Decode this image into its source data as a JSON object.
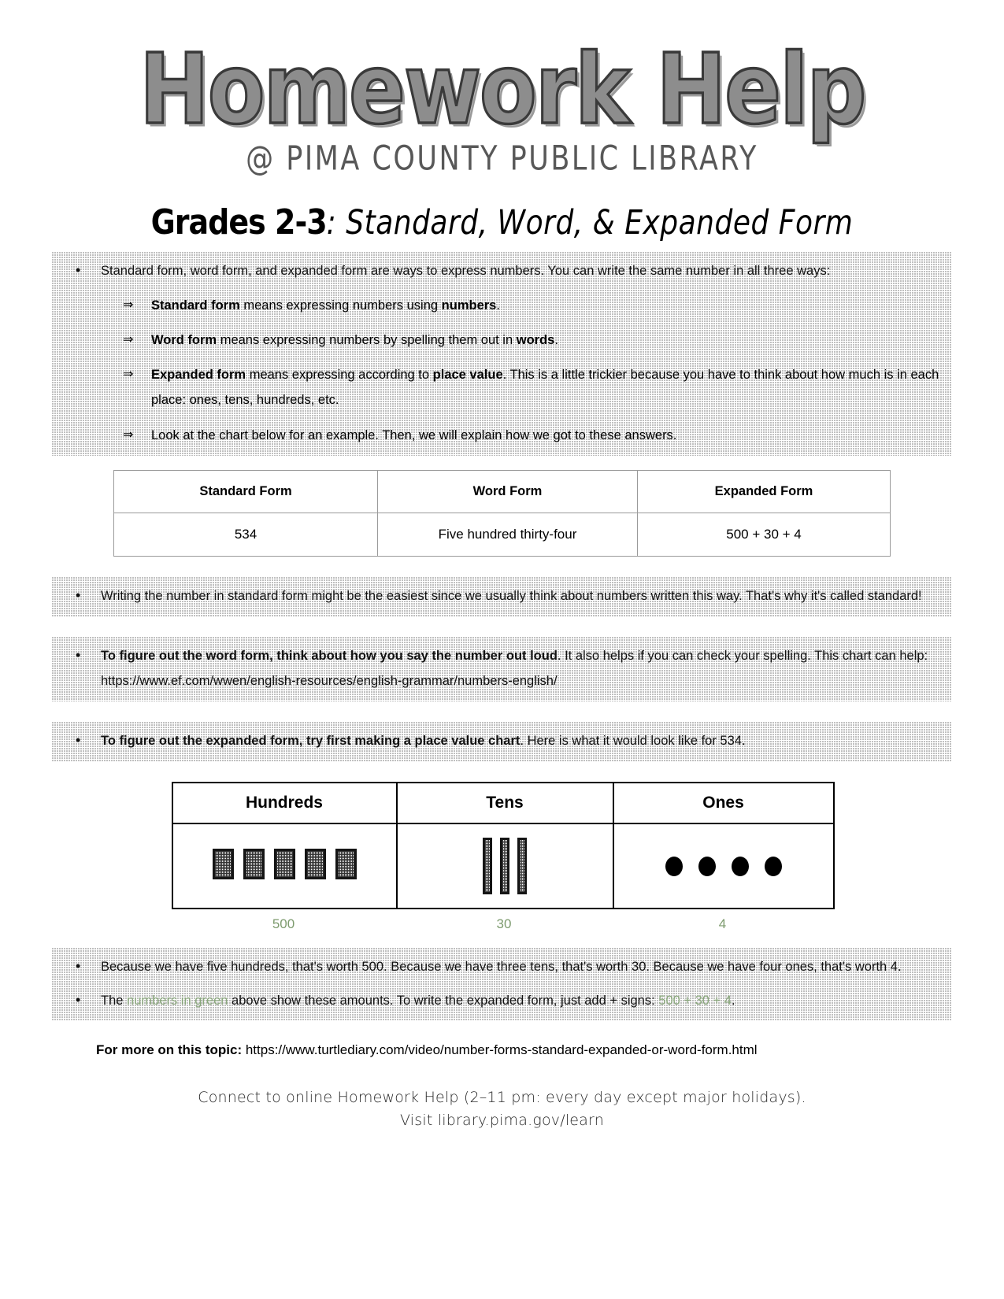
{
  "header": {
    "logo_main": "Homework Help",
    "logo_sub": "@ PIMA COUNTY PUBLIC LIBRARY"
  },
  "title": {
    "grade": "Grades 2-3",
    "rest": ": Standard, Word, & Expanded Form"
  },
  "intro": {
    "bullet": "Standard form, word form, and expanded form are ways to express numbers. You can write the same number in all three ways:",
    "sub_items": [
      {
        "bold": "Standard form",
        "text": " means expressing numbers using ",
        "bold2": "numbers",
        "tail": "."
      },
      {
        "bold": "Word form",
        "text": " means expressing numbers by spelling them out in ",
        "bold2": "words",
        "tail": "."
      },
      {
        "bold": "Expanded form",
        "text": " means expressing according to ",
        "bold2": "place value",
        "tail": ". This is a little trickier because you have to think about how much is in each place: ones, tens, hundreds, etc."
      },
      {
        "bold": "",
        "text": "Look at the chart below for an example. Then, we will explain how we got to these answers.",
        "bold2": "",
        "tail": ""
      }
    ]
  },
  "example_table": {
    "headers": [
      "Standard Form",
      "Word Form",
      "Expanded Form"
    ],
    "row": [
      "534",
      "Five hundred thirty-four",
      "500 + 30 + 4"
    ]
  },
  "note_standard": "Writing the number in standard form might be the easiest since we usually think about numbers written this way. That's why it's called standard!",
  "note_word": {
    "bold": "To figure out the word form, think about how you say the number out loud",
    "text": ". It also helps if you can check your spelling. This chart can help: https://www.ef.com/wwen/english-resources/english-grammar/numbers-english/"
  },
  "note_expanded": {
    "bold": "To figure out the expanded form, try first making a place value chart",
    "text": ". Here is what it would look like for 534."
  },
  "place_value_chart": {
    "columns": [
      {
        "header": "Hundreds",
        "count": 5,
        "shape": "square-block",
        "label": "500"
      },
      {
        "header": "Tens",
        "count": 3,
        "shape": "rod",
        "label": "30"
      },
      {
        "header": "Ones",
        "count": 4,
        "shape": "dot",
        "label": "4"
      }
    ]
  },
  "explanation": {
    "bullet1": "Because we have five hundreds, that's worth 500. Because we have three tens, that's worth 30. Because we have four ones, that's worth 4.",
    "bullet2_pre": "The ",
    "bullet2_green1": "numbers in green",
    "bullet2_mid": " above show these amounts. To write the expanded form, just add + signs: ",
    "bullet2_green2": "500 + 30 + 4",
    "bullet2_tail": "."
  },
  "more": {
    "label": "For more on this topic:",
    "url": " https://www.turtlediary.com/video/number-forms-standard-expanded-or-word-form.html"
  },
  "footer": {
    "line1": "Connect to online Homework Help (2–11 pm: every day except major holidays).",
    "line2": "Visit library.pima.gov/learn"
  },
  "colors": {
    "green": "#8aa87c",
    "shade": "#b4b4b4",
    "logo_gray": "#8d8d8d"
  }
}
